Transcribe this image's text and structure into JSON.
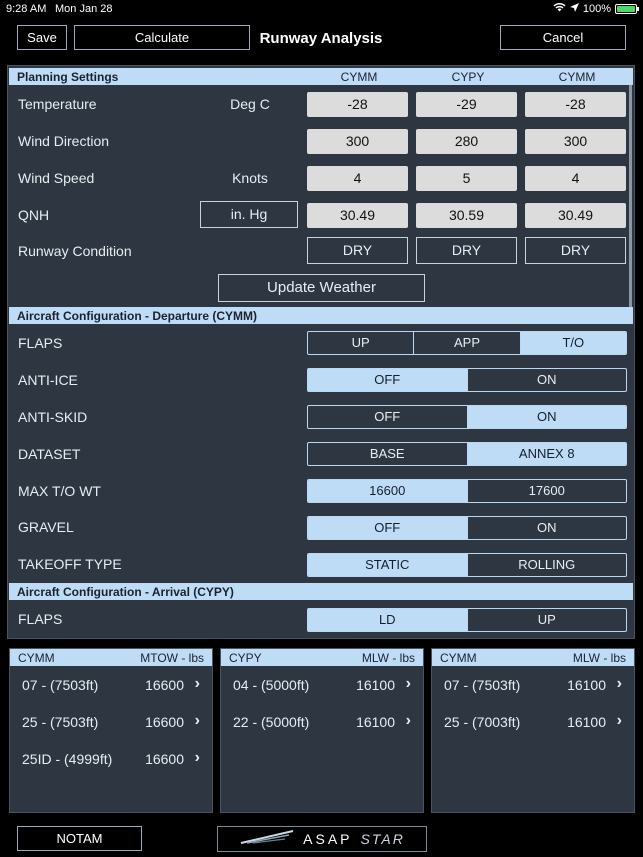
{
  "status": {
    "time": "9:28 AM",
    "date": "Mon Jan 28",
    "battery": "100%"
  },
  "toolbar": {
    "save": "Save",
    "calculate": "Calculate",
    "title": "Runway Analysis",
    "cancel": "Cancel"
  },
  "planning": {
    "header": "Planning Settings",
    "airports": [
      "CYMM",
      "CYPY",
      "CYMM"
    ],
    "temperature": {
      "label": "Temperature",
      "unit": "Deg C",
      "values": [
        "-28",
        "-29",
        "-28"
      ]
    },
    "wind_direction": {
      "label": "Wind Direction",
      "values": [
        "300",
        "280",
        "300"
      ]
    },
    "wind_speed": {
      "label": "Wind Speed",
      "unit": "Knots",
      "values": [
        "4",
        "5",
        "4"
      ]
    },
    "qnh": {
      "label": "QNH",
      "unit": "in. Hg",
      "values": [
        "30.49",
        "30.59",
        "30.49"
      ]
    },
    "runway_condition": {
      "label": "Runway Condition",
      "values": [
        "DRY",
        "DRY",
        "DRY"
      ]
    },
    "update_weather": "Update Weather"
  },
  "departure": {
    "header": "Aircraft Configuration - Departure (CYMM)",
    "rows": [
      {
        "label": "FLAPS",
        "options": [
          "UP",
          "APP",
          "T/O"
        ],
        "selected": 2
      },
      {
        "label": "ANTI-ICE",
        "options": [
          "OFF",
          "ON"
        ],
        "selected": 0
      },
      {
        "label": "ANTI-SKID",
        "options": [
          "OFF",
          "ON"
        ],
        "selected": 1
      },
      {
        "label": "DATASET",
        "options": [
          "BASE",
          "ANNEX 8"
        ],
        "selected": 1
      },
      {
        "label": "MAX T/O WT",
        "options": [
          "16600",
          "17600"
        ],
        "selected": 0
      },
      {
        "label": "GRAVEL",
        "options": [
          "OFF",
          "ON"
        ],
        "selected": 0
      },
      {
        "label": "TAKEOFF TYPE",
        "options": [
          "STATIC",
          "ROLLING"
        ],
        "selected": 0
      }
    ]
  },
  "arrival": {
    "header": "Aircraft Configuration - Arrival (CYPY)",
    "rows": [
      {
        "label": "FLAPS",
        "options": [
          "LD",
          "UP"
        ],
        "selected": 0
      }
    ]
  },
  "results": [
    {
      "airport": "CYMM",
      "metric": "MTOW - lbs",
      "rows": [
        {
          "runway": "07 - (7503ft)",
          "weight": "16600"
        },
        {
          "runway": "25 - (7503ft)",
          "weight": "16600"
        },
        {
          "runway": "25ID - (4999ft)",
          "weight": "16600"
        }
      ]
    },
    {
      "airport": "CYPY",
      "metric": "MLW - lbs",
      "rows": [
        {
          "runway": "04 - (5000ft)",
          "weight": "16100"
        },
        {
          "runway": "22 - (5000ft)",
          "weight": "16100"
        }
      ]
    },
    {
      "airport": "CYMM",
      "metric": "MLW - lbs",
      "rows": [
        {
          "runway": "07 - (7503ft)",
          "weight": "16100"
        },
        {
          "runway": "25 - (7003ft)",
          "weight": "16100"
        }
      ]
    }
  ],
  "bottom": {
    "notam": "NOTAM",
    "logo_a": "ASAP",
    "logo_b": "STAR"
  }
}
